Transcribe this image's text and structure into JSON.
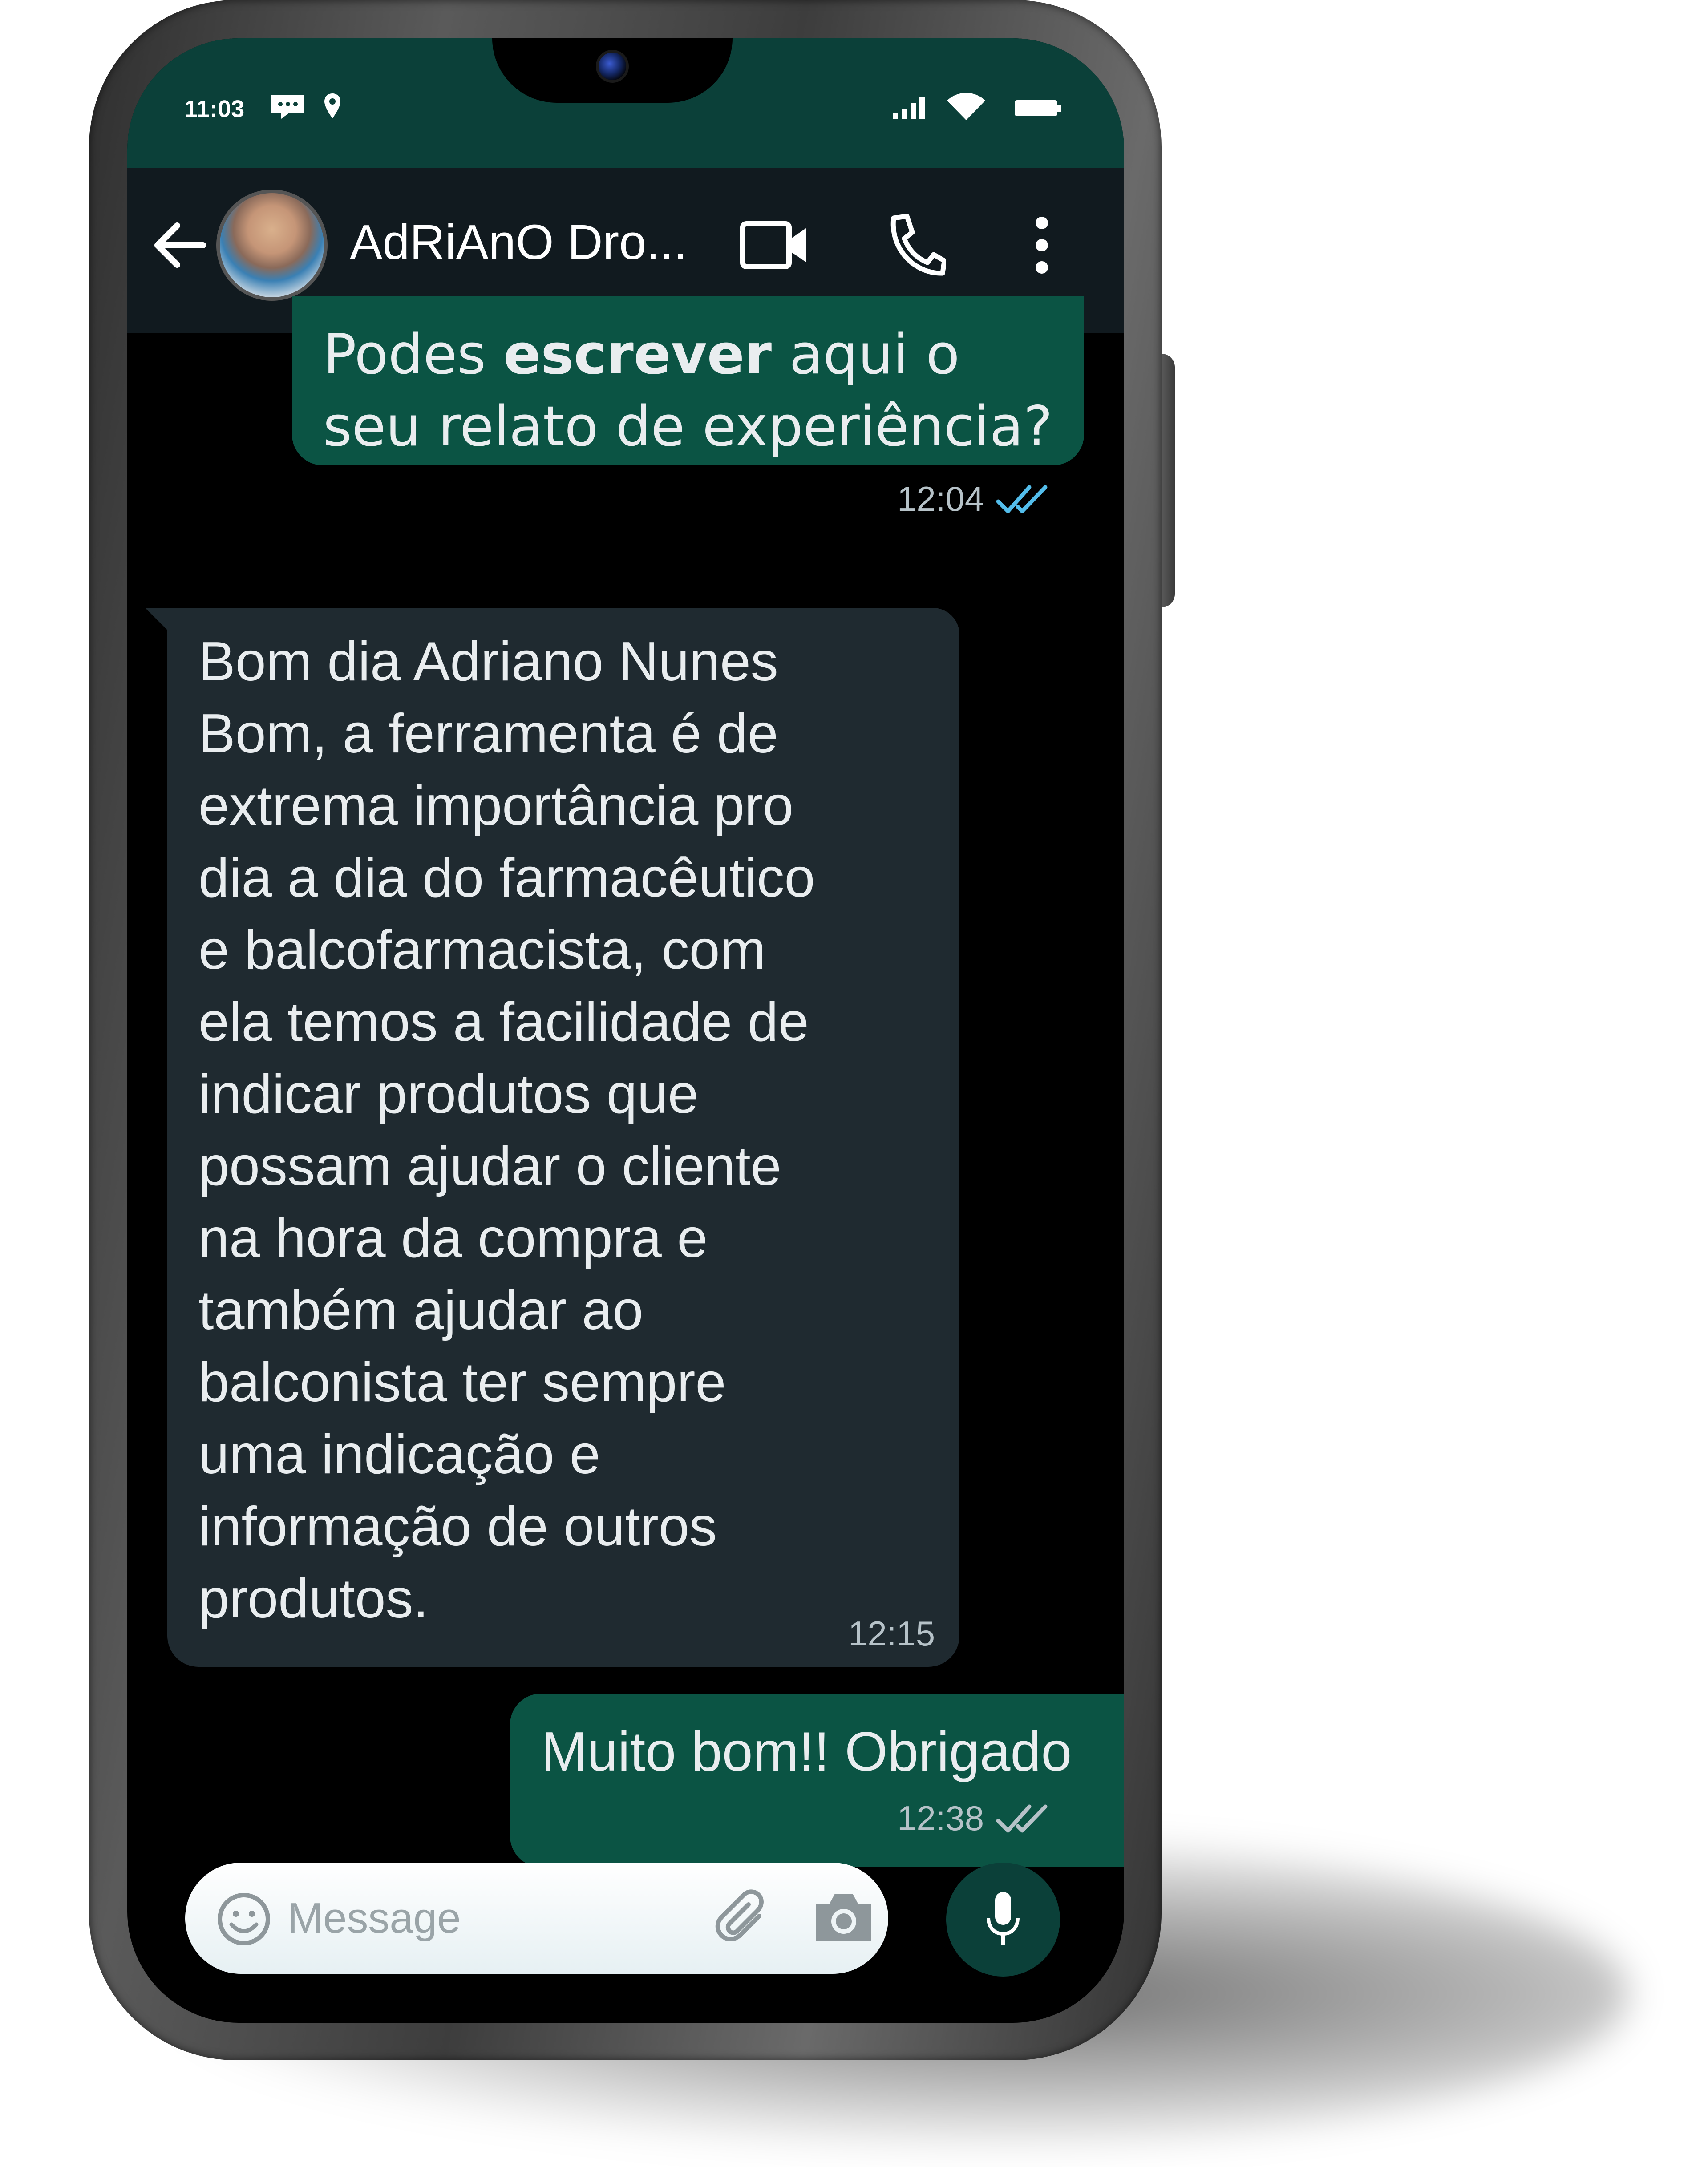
{
  "status_bar": {
    "time": "11:03",
    "icons": [
      "message-icon",
      "location-icon",
      "signal-icon",
      "wifi-icon",
      "battery-icon"
    ]
  },
  "chat_header": {
    "contact_name": "AdRiAnO Dro...",
    "icons": [
      "back-arrow-icon",
      "video-call-icon",
      "voice-call-icon",
      "more-options-icon"
    ]
  },
  "messages": [
    {
      "direction": "outgoing",
      "text_before": "Podes ",
      "text_bold": "escrever",
      "text_after": "  aqui o\nseu relato de experiência?",
      "time": "12:04",
      "status": "read"
    },
    {
      "direction": "incoming",
      "text": "Bom dia Adriano Nunes\nBom, a ferramenta é de\nextrema importância pro\ndia a dia do farmacêutico\ne balcofarmacista, com\nela temos a facilidade de\nindicar produtos que\npossam ajudar o cliente\nna hora da compra e\ntambém ajudar ao\nbalconista ter sempre\numa indicação e\ninformação de outros\nprodutos.",
      "time": "12:15"
    },
    {
      "direction": "outgoing",
      "text": "Muito bom!! Obrigado",
      "time": "12:38",
      "status": "delivered"
    }
  ],
  "composer": {
    "placeholder": "Message",
    "icons": [
      "emoji-icon",
      "attach-icon",
      "camera-icon",
      "mic-icon"
    ]
  },
  "colors": {
    "status_bar": "#0b4039",
    "header": "#111a1f",
    "outgoing_bubble": "#0b5444",
    "incoming_bubble": "#1f2a30",
    "read_ticks": "#53bdeb"
  }
}
